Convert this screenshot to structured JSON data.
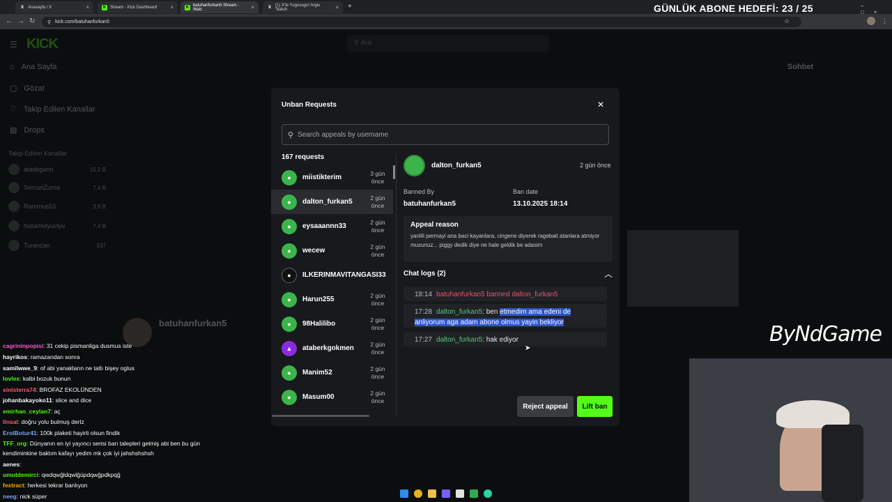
{
  "browser": {
    "tabs": [
      {
        "icon": "X",
        "label": "Anasayfa / X"
      },
      {
        "icon": "K",
        "label": "Stream - Kick Dashboard"
      },
      {
        "icon": "K",
        "label": "batuhanfurkan5 Stream - Watc"
      },
      {
        "icon": "X",
        "label": "(1) X'te Yugusugu! Argiu \"batuh"
      }
    ],
    "url": "kick.com/batuhanfurkan5"
  },
  "overlay": {
    "goal": "GÜNLÜK ABONE HEDEFİ: 23 / 25",
    "brand": "ByNdGame"
  },
  "site": {
    "logo": "KICK",
    "search_placeholder": "Ara",
    "nav": [
      "Ana Sayfa",
      "Gözat",
      "Takip Edilen Kanallar",
      "Drops"
    ],
    "followed_title": "Takip Edilen Kanallar",
    "followed": [
      {
        "name": "atadogann",
        "count": "15,2 B"
      },
      {
        "name": "SercanZurna",
        "count": "7,4 B"
      },
      {
        "name": "Rammus53",
        "count": "3,9 B"
      },
      {
        "name": "husamvlyuvlyu",
        "count": "7,4 B"
      },
      {
        "name": "Turancan",
        "count": "937"
      }
    ],
    "chat_title": "Sohbet",
    "channel_name": "batuhanfurkan5"
  },
  "stream_chat": [
    {
      "user": "cagrininpopisi",
      "color": "#ff5fd7",
      "msg": ": 31 cekip pismanliga dusmus iste"
    },
    {
      "user": "hayrikos",
      "color": "#ffffff",
      "msg": ": ramazandan sonra"
    },
    {
      "user": "samilwwe_9",
      "color": "#ffffff",
      "msg": ": of abi yanakların ne tatlı bişey oglus"
    },
    {
      "user": "lovles",
      "color": "#53fc18",
      "msg": ": kalbi bozuk bunun"
    },
    {
      "user": "sinisterra74",
      "color": "#ff5f7a",
      "msg": ": BROFAZ EKOLÜNDEN"
    },
    {
      "user": "johanbakayoko11",
      "color": "#ffffff",
      "msg": ": slice and dice"
    },
    {
      "user": "emirhan_ceylan7",
      "color": "#53fc18",
      "msg": ": aç"
    },
    {
      "user": "linsal",
      "color": "#ff5f7a",
      "msg": ": doğru yolu bulmuş derlz"
    },
    {
      "user": "ErolBotur41",
      "color": "#7fa8ff",
      "msg": ": 100k plaketi hayirli olsun findik"
    },
    {
      "user": "TFF_org",
      "color": "#53fc18",
      "msg": ": Dünyanın en iyi yayıncı serisi ban talepleri gelmiş abi ben bu gün"
    },
    {
      "user": "",
      "color": "#ffffff",
      "msg": "kendiminkine baktım kafayı yedim mk çok iyi jahshshshsh"
    },
    {
      "user": "aenes",
      "color": "#ffffff",
      "msg": ":"
    },
    {
      "user": "umutdemirci",
      "color": "#53fc18",
      "msg": ": qwdqwğldqwlğüpdqwğpdkpqğ"
    },
    {
      "user": "fextract",
      "color": "#ffb000",
      "msg": ": herkesi tekrar banlıyon"
    },
    {
      "user": "neeg",
      "color": "#7fa8ff",
      "msg": ": nick süper"
    }
  ],
  "modal": {
    "title": "Unban Requests",
    "search_placeholder": "Search appeals by username",
    "count_label": "167 requests",
    "requests": [
      {
        "name": "miistikterim",
        "ago": "3 gün önce"
      },
      {
        "name": "dalton_furkan5",
        "ago": "2 gün önce"
      },
      {
        "name": "eysaaannn33",
        "ago": "2 gün önce"
      },
      {
        "name": "wecew",
        "ago": "2 gün önce"
      },
      {
        "name": "ILKERINMAVITANGASI33",
        "ago": ""
      },
      {
        "name": "Harun255",
        "ago": "2 gün önce"
      },
      {
        "name": "98Halilibo",
        "ago": "2 gün önce"
      },
      {
        "name": "ataberkgokmen",
        "ago": "2 gün önce"
      },
      {
        "name": "Manim52",
        "ago": "2 gün önce"
      },
      {
        "name": "Masum00",
        "ago": "2 gün önce"
      }
    ],
    "detail": {
      "username": "dalton_furkan5",
      "ago": "2 gün önce",
      "banned_by_label": "Banned By",
      "banned_by": "batuhanfurkan5",
      "ban_date_label": "Ban date",
      "ban_date": "13.10.2025 18:14",
      "appeal_title": "Appeal reason",
      "appeal_text": "yanlili permayi ana baci kayanlara, cingene diyerek ragebait atanlara atmiyor musunuz... piggy dedik diye ne hale geldik be adasim",
      "chat_logs_title": "Chat logs (2)",
      "logs": [
        {
          "time": "18:14",
          "user": "",
          "msg": "batuhanfurkan5 banned dalton_furkan5"
        },
        {
          "time": "17:28",
          "user": "dalton_furkan5",
          "pre": ": ben ",
          "msg": "etmedim ama edeni de anliyorum aga adam abone olmus yayin bekliyor"
        },
        {
          "time": "17:27",
          "user": "dalton_furkan5",
          "pre": ": ",
          "msg": "hak ediyor"
        }
      ]
    },
    "reject_label": "Reject appeal",
    "lift_label": "Lift ban"
  }
}
